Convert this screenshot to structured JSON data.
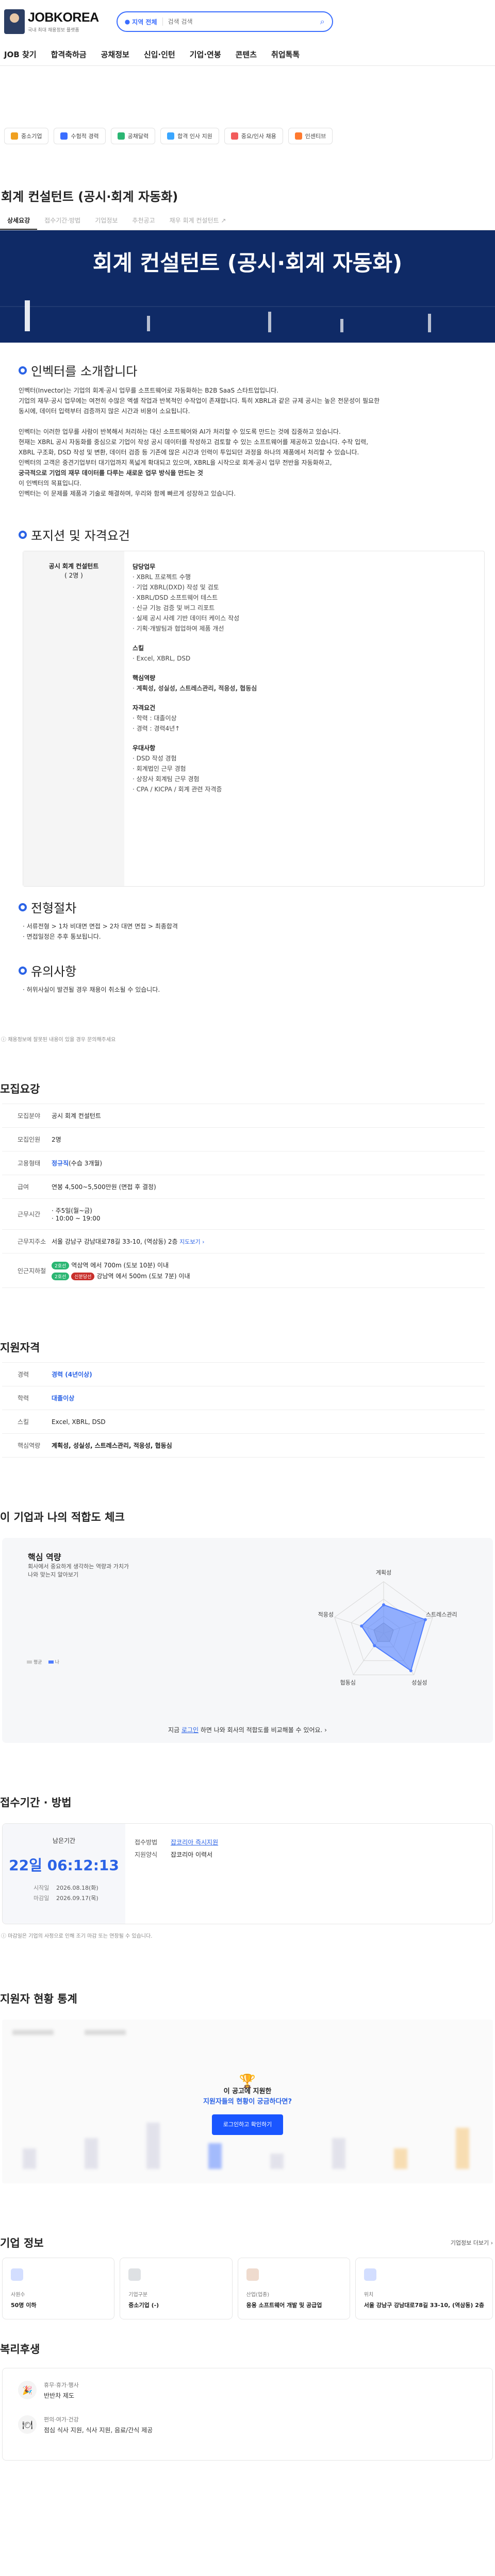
{
  "header": {
    "logo_text": "JOBKOREA",
    "logo_sub": "국내 최대 채용정보 플랫폼",
    "region_label": "지역 전체",
    "search_placeholder": "검색 검색",
    "gnb": [
      "JOB 찾기",
      "합격축하금",
      "공채정보",
      "신입·인턴",
      "기업·연봉",
      "콘텐츠",
      "취업톡톡"
    ]
  },
  "quick_links": [
    {
      "label": "중소기업",
      "color": "#f0a020"
    },
    {
      "label": "수험적 경력",
      "color": "#3a6dff"
    },
    {
      "label": "공채달력",
      "color": "#2bb673"
    },
    {
      "label": "합격 인사 지원",
      "color": "#3aa6ff"
    },
    {
      "label": "중요/인사 채용",
      "color": "#f25c5c"
    },
    {
      "label": "인센티브",
      "color": "#ff7a2f"
    }
  ],
  "job": {
    "title": "회계 컨설턴트 (공시·회계 자동화)",
    "tabs": [
      "상세요강",
      "접수기간·방법",
      "기업정보",
      "추천공고",
      "채우 회계 컨설턴트 ↗"
    ],
    "banner_title": "회계 컨설턴트 (공시·회계 자동화)"
  },
  "intro": {
    "heading": "인벡터를 소개합니다",
    "p1": "인벡터(Invector)는 기업의 회계·공시 업무를 소프트웨어로 자동화하는 B2B SaaS 스타트업입니다.",
    "p2": "기업의 재무·공시 업무에는 여전히 수많은 엑셀 작업과 반복적인 수작업이 존재합니다. 특히 XBRL과 같은 규제 공시는 높은 전문성이 필요한",
    "p3": "동시에, 데이터 입력부터 검증까지 많은 시간과 비용이 소요됩니다.",
    "p4": "인벡터는 이러한 업무를 사람이 반복해서 처리하는 대신 소프트웨어와 AI가 처리할 수 있도록 만드는 것에 집중하고 있습니다.",
    "p5": "현재는 XBRL 공시 자동화를 중심으로 기업이 작성 공시 데이터를 작성하고 검토할 수 있는 소프트웨어를 제공하고 있습니다. 수작 입력,",
    "p6": "XBRL 구조화, DSD 작성 및 변환, 데이터 검증 등 기존에 많은 시간과 인력이 투입되던 과정을 하나의 제품에서 처리할 수 있습니다.",
    "p7": "인벡터의 고객은 중견기업부터 대기업까지 폭넓게 확대되고 있으며, XBRL을 시작으로 회계·공시 업무 전반을 자동화하고,",
    "p8": "궁극적으로 기업의 재무 데이터를 다루는 새로운 업무 방식을 만드는 것",
    "p9": "이 인벡터의 목표입니다.",
    "p10": "인벡터는 이 문제를 제품과 기술로 해결하며, 우리와 함께 빠르게 성장하고 있습니다."
  },
  "position": {
    "heading": "포지션 및 자격요건",
    "left_title": "공시 회계 컨설턴트",
    "left_count": "( 2명 )",
    "duty_title": "담당업무",
    "duties": [
      "· XBRL 프로젝트 수행",
      "· 기업 XBRL(DXD) 작성 및 검토",
      "· XBRL/DSD 소프트웨어 테스트",
      "· 신규 기능 검증 및 버그 리포트",
      "· 실제 공시 사례 기반 데이터 케이스 작성",
      "· 기획·개발팀과 협업하여 제품 개선"
    ],
    "skill_title": "스킬",
    "skills": "· Excel, XBRL, DSD",
    "keyword_title": "핵심역량",
    "keywords": "계획성, 성실성, 스트레스관리, 적응성, 협동심",
    "qual_title": "자격요건",
    "quals": [
      "· 학력 : 대졸이상",
      "· 경력 : 경력4년↑"
    ],
    "pref_title": "우대사항",
    "prefs": [
      "· DSD 작성 경험",
      "· 회계법인 근무 경험",
      "· 상장사 회계팀 근무 경험",
      "· CPA / KICPA / 회계 관련 자격증"
    ]
  },
  "process": {
    "heading": "전형절차",
    "line1": "· 서류전형 > 1차 비대면 면접 > 2차 대면 면접 > 최종합격",
    "line2": "· 면접일정은 추후 통보됩니다."
  },
  "caution": {
    "heading": "유의사항",
    "line1": "· 허위사실이 발견될 경우 채용이 취소될 수 있습니다."
  },
  "notice": "채용정보에 잘못된 내용이 있을 경우 문의해주세요",
  "summary": {
    "heading": "모집요강",
    "rows": [
      {
        "k": "모집분야",
        "v": "공시 회계 컨설턴트"
      },
      {
        "k": "모집인원",
        "v": "2명"
      },
      {
        "k": "고용형태",
        "v_blue": "정규직",
        "v": "(수습 3개월)"
      },
      {
        "k": "급여",
        "v": "연봉 4,500~5,500만원 (면접 후 결정)"
      },
      {
        "k": "근무시간",
        "v": "· 주5일(월~금)",
        "v2": "· 10:00 ~ 19:00"
      },
      {
        "k": "근무지주소",
        "v": "서울 강남구 강남대로78길 33-10, (역삼동) 2층",
        "link": "지도보기 ›"
      },
      {
        "k": "인근지하철",
        "sub1_tag": "2호선",
        "sub1": "역삼역 에서 700m (도보 10분) 이내",
        "sub2_tag1": "2호선",
        "sub2_tag2": "신분당선",
        "sub2": "강남역 에서 500m (도보 7분) 이내"
      }
    ]
  },
  "requirements": {
    "heading": "지원자격",
    "rows": [
      {
        "k": "경력",
        "v": "경력 (4년이상)"
      },
      {
        "k": "학력",
        "v": "대졸이상"
      },
      {
        "k": "스킬",
        "v": "Excel, XBRL, DSD"
      },
      {
        "k": "핵심역량",
        "v": "계획성, 성실성, 스트레스관리, 적응성, 협동심"
      }
    ]
  },
  "fit": {
    "heading": "이 기업과 나의 적합도 체크",
    "box_title": "핵심 역량",
    "desc1": "회사에서 중요하게 생각하는 역량과 가치가",
    "desc2": "나와 맞는지 알아보기",
    "axes": [
      "계획성",
      "스트레스관리",
      "성실성",
      "협동심",
      "적응성"
    ],
    "company_values": [
      0.55,
      0.85,
      0.9,
      0.3,
      0.45
    ],
    "me_values": [
      0.2,
      0.2,
      0.2,
      0.2,
      0.2
    ],
    "legend_me": "평균",
    "legend_company": "나",
    "login_pre": "지금 ",
    "login_link": "로그인",
    "login_post": " 하면 나와 회사의 적합도를 비교해볼 수 있어요. ›",
    "company_color": "#4f7dff"
  },
  "apply": {
    "heading": "접수기간 · 방법",
    "remain_label": "남은기간",
    "countdown": "22일 06:12:13",
    "start_k": "시작일",
    "start_v": "2026.08.18(화)",
    "end_k": "마감일",
    "end_v": "2026.09.17(목)",
    "method_k": "접수방법",
    "method_v": "잡코리아 즉시지원",
    "form_k": "지원양식",
    "form_v": "잡코리아 이력서",
    "notice": "마감일은 기업의 사정으로 인해 조기 마감 또는 연장될 수 있습니다."
  },
  "stats": {
    "heading": "지원자 현황 통계",
    "line1": "이 공고에 지원한",
    "line2": "지원자들의 현황이 궁금하다면?",
    "button": "로그인하고 확인하기"
  },
  "company": {
    "heading": "기업 정보",
    "more": "기업정보 더보기 ›",
    "cards": [
      {
        "k": "사원수",
        "v": "50명 이하",
        "color": "#4f7dff"
      },
      {
        "k": "기업구분",
        "v": "중소기업 (-)",
        "color": "#7b8794"
      },
      {
        "k": "산업(업종)",
        "v": "응용 소프트웨어 개발 및 공급업",
        "color": "#c0713a"
      },
      {
        "k": "위치",
        "v": "서울 강남구 강남대로78길 33-10, (역삼동) 2층",
        "color": "#4f7dff"
      }
    ]
  },
  "welfare": {
    "heading": "복리후생",
    "rows": [
      {
        "k": "휴무·휴가·행사",
        "v": "반반차 제도",
        "icon": "🎉"
      },
      {
        "k": "편의·여가·건강",
        "v": "점심 식사 지원, 식사 지원, 음료/간식 제공",
        "icon": "🍽"
      }
    ]
  }
}
